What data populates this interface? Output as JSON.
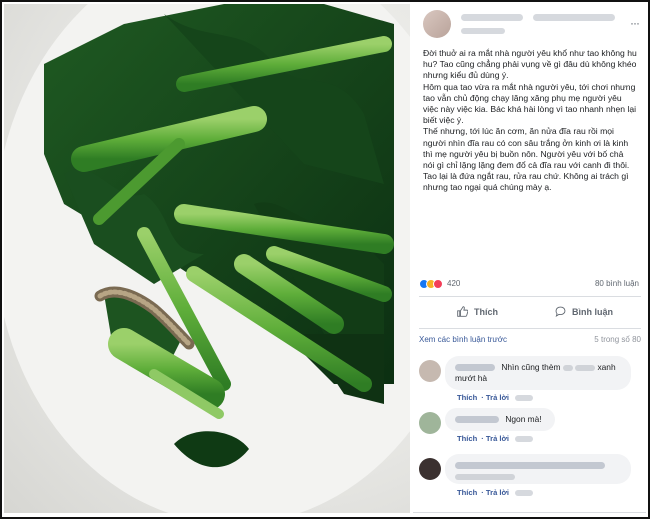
{
  "post": {
    "more_icon": "···",
    "body_paragraphs": [
      "Đời thuở ai ra mắt nhà người yêu khổ như tao không hu hu? Tao cũng chẳng phải vụng về gì đâu dù không khéo nhưng kiểu đủ dùng ý.",
      "Hôm qua tao vừa ra mắt nhà người yêu, tới chơi nhưng tao vẫn chủ động chạy lăng xăng phụ mẹ người yêu việc này việc kia. Bác khá hài lòng vì tao nhanh nhẹn lại biết việc ý.",
      "Thế nhưng, tới lúc ăn cơm, ăn nửa đĩa rau rồi mọi người nhìn đĩa rau có con sâu trắng ởn kinh ơi là kinh thì mẹ người yêu bị buồn nôn. Người yêu với bố chả nói gì chỉ lặng lặng đem đổ cả đĩa rau với canh đi thôi.",
      "Tao lại là đứa ngắt rau, rửa rau chứ. Không ai trách gì nhưng tao ngại quá chúng mày ạ."
    ],
    "reaction_count": "420",
    "comment_count": "80 bình luận",
    "like_label": "Thích",
    "comment_label": "Bình luận",
    "view_more": "Xem các bình luận trước",
    "paging": "5 trong số 80"
  },
  "comments": [
    {
      "text_a": "Nhìn cũng thèm",
      "text_b": "xanh mướt hà",
      "like": "Thích",
      "reply": "Trả lời"
    },
    {
      "text": "Ngon mà!",
      "like": "Thích",
      "reply": "Trả lời"
    },
    {
      "like": "Thích",
      "reply": "Trả lời"
    }
  ],
  "colors": {
    "link": "#385898",
    "like_blue": "#1877f2",
    "bubble": "#f2f3f5"
  },
  "icons": [
    "more-icon",
    "like-reaction-icon",
    "haha-reaction-icon",
    "love-reaction-icon",
    "thumbs-up-icon",
    "comment-icon"
  ]
}
